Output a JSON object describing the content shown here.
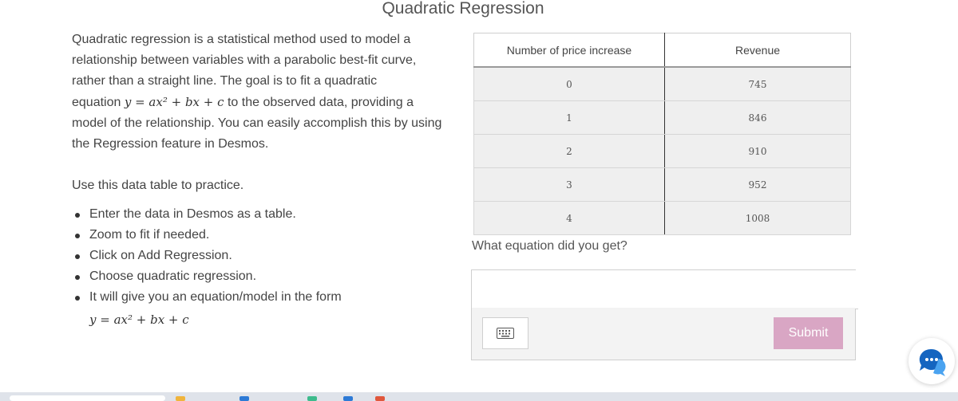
{
  "page": {
    "title": "Quadratic Regression"
  },
  "intro": {
    "line1": "Quadratic regression is a statistical method used to model a relationship between variables with a parabolic best-fit curve, rather than a straight line. The goal is to fit a quadratic",
    "equation_prefix": "equation ",
    "equation": "y = ax² + bx + c",
    "line2": " to the observed data, providing a model of the relationship.  You can easily accomplish this by using the Regression feature in Desmos."
  },
  "practice_label": "Use this data table to practice.",
  "steps": [
    "Enter the data in Desmos as a table.",
    "Zoom to fit if needed.",
    "Click on Add Regression.",
    "Choose quadratic regression.",
    "It will give you an equation/model in the form"
  ],
  "form_equation": "y = ax² + bx + c",
  "table": {
    "headers": [
      "Number of price increase",
      "Revenue"
    ],
    "rows": [
      [
        "0",
        "745"
      ],
      [
        "1",
        "846"
      ],
      [
        "2",
        "910"
      ],
      [
        "3",
        "952"
      ],
      [
        "4",
        "1008"
      ]
    ]
  },
  "question": "What equation did you get?",
  "answer": {
    "value": "",
    "placeholder": ""
  },
  "submit_label": "Submit",
  "icons": {
    "keyboard": "keyboard-icon",
    "chat": "chat-bubble-icon"
  },
  "colors": {
    "submit": "#d9a6c4",
    "chat": "#1565c0"
  }
}
